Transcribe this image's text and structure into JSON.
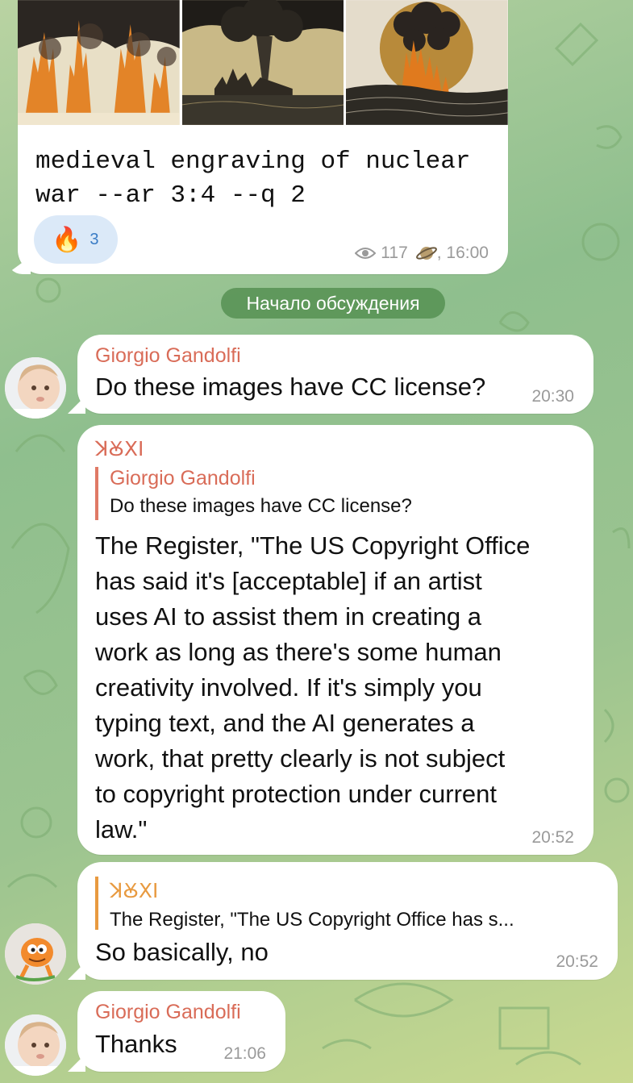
{
  "post": {
    "caption_line1": "medieval engraving of nuclear",
    "caption_line2": "war --ar 3:4 --q 2",
    "reaction_emoji": "🔥",
    "reaction_count": "3",
    "views": "117",
    "time": ", 16:00"
  },
  "divider": {
    "label": "Начало обсуждения"
  },
  "messages": [
    {
      "sender": "Giorgio Gandolfi",
      "text": "Do these images have CC license?",
      "time": "20:30"
    },
    {
      "sender": "ꓘꙊꓫꓲ",
      "quote_sender": "Giorgio Gandolfi",
      "quote_text": "Do these images have CC license?",
      "lines": [
        "The Register, \"The US Copyright Office",
        "has said it's [acceptable] if an artist",
        "uses AI to assist them in creating a",
        "work as long as there's some human",
        "creativity involved. If it's simply you",
        "typing text, and the AI generates a",
        "work, that pretty clearly is not subject",
        "to copyright protection under current",
        "law.\""
      ],
      "time": "20:52"
    },
    {
      "quote_sender": "ꓘꙊꓫꓲ",
      "quote_text": "The Register, \"The US Copyright Office has s...",
      "text": "So basically, no",
      "time": "20:52"
    },
    {
      "sender": "Giorgio Gandolfi",
      "text": "Thanks",
      "time": "21:06"
    }
  ],
  "colors": {
    "sender": "#d96c58",
    "quote_orange": "#e89a40",
    "divider_bg": "#5f9a5a"
  }
}
